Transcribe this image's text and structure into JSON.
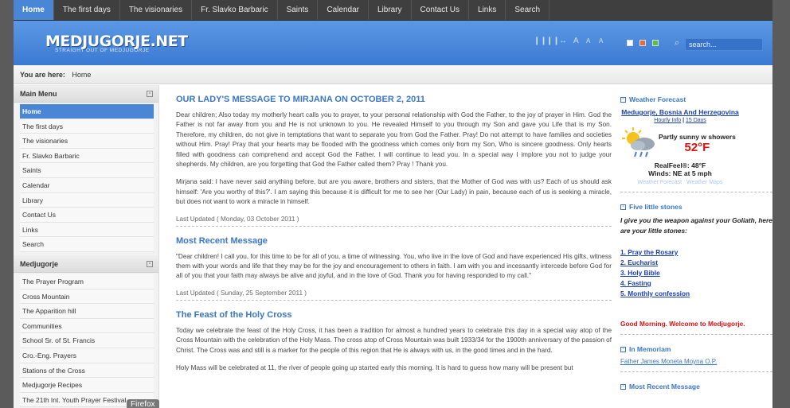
{
  "nav": {
    "items": [
      "Home",
      "The first days",
      "The visionaries",
      "Fr. Slavko Barbaric",
      "Saints",
      "Calendar",
      "Library",
      "Contact Us",
      "Links",
      "Search"
    ]
  },
  "header": {
    "logo_title": "MEDJUGORJE.NET",
    "logo_subtitle": "STRAIGHT OUT OF MEDJUGORJE",
    "search_placeholder": "search..."
  },
  "breadcrumb": {
    "label": "You are here:",
    "current": "Home"
  },
  "main_menu": {
    "title": "Main Menu",
    "items": [
      "Home",
      "The first days",
      "The visionaries",
      "Fr. Slavko Barbaric",
      "Saints",
      "Calendar",
      "Library",
      "Contact Us",
      "Links",
      "Search"
    ]
  },
  "medjugorje_menu": {
    "title": "Medjugorje",
    "items": [
      "The Prayer Program",
      "Cross Mountain",
      "The Apparition hill",
      "Communities",
      "School Sr. of St. Francis",
      "Cro.-Eng. Prayers",
      "Stations of the Cross",
      "Medjugorje Recipes",
      "The 21th Int. Youth Prayer Festival"
    ]
  },
  "firefox_tip": "Firefox",
  "articles": [
    {
      "title": "OUR LADY'S MESSAGE TO MIRJANA ON OCTOBER 2, 2011",
      "paragraphs": [
        "Dear children; Also today my motherly heart calls you to prayer, to your personal relationship with God the Father, to the joy of prayer in Him. God the Father is not far away from you and He is not unknown to you. He revealed Himself to you through my Son and gave you Life that is my Son. Therefore, my children, do not give in temptations that want to separate you from God the Father. Pray! Do not attempt to have families and societies without Him. Pray! Pray that your hearts may be flooded with the goodness which comes only from my Son, Who is sincere goodness. Only hearts filled with goodness can comprehend and accept God the Father. I will continue to lead you. In a special way I implore you not to judge your shepherds. My children, are you forgetting that God the Father called them? Pray ! Thank you.",
        "Mirjana said: I have never said anything before, but are you aware, brothers and sisters, that the Mother of God was with us? Each of us should ask himself: 'Are you worthy of this?'. I am saying this because it is difficult for me to see her (Our Lady) in pain, because each of us is seeking a miracle, but does not want to work a miracle in himself."
      ],
      "updated": "Last Updated ( Monday, 03 October 2011 )"
    },
    {
      "title": "Most Recent Message",
      "paragraphs": [
        "\"Dear children! I call you, for this time to be for all of you, a time of witnessing. You, who live in the love of God and have experienced His gifts, witness them with your words and life that they may be for the joy and encouragement to others in faith. I am with you and incessantly intercede before God for all of you that your faith may always be alive and joyful, and in the love of God. Thank you for having responded to my call.\""
      ],
      "updated": "Last Updated ( Sunday, 25 September 2011 )"
    },
    {
      "title": "The Feast of the Holy Cross",
      "paragraphs": [
        "Today we celebrate the feast of the Holy Cross, it has been a tradition for almost a hundred years to celebrate this day in a special way atop of the Cross Mountain with the celebration of the Holy Mass. The cross  atop of Cross Mountain was built 1933/34 for the 1900th anniversary of the passion of Christ. The Cross was and still is a marker for the people of this region that He is always with us, in the good times and in the hard.",
        "Holy Mass will be celebrated at 11, the river of people going up started early this morning. It is hard to guess how many will be present but"
      ]
    }
  ],
  "weather": {
    "title": "Weather Forecast",
    "city": "Medugorje, Bosnia And Herzegovina",
    "link_hourly": "Hourly Info",
    "link_sep": " | ",
    "link_days": "15 Days",
    "condition": "Partly sunny w showers",
    "temp": "52°F",
    "realfeel": "RealFeel®: 48°F",
    "winds": "Winds: NE at 5 mph",
    "foot_forecast": "Weather Forecast",
    "foot_maps": "Weather Maps"
  },
  "stones": {
    "title": "Five little stones",
    "intro": "I give you the weapon against your Goliath, here are your little stones:",
    "items": [
      "1. Pray the Rosary",
      "2. Eucharist",
      "3. Holy Bible",
      "4. Fasting",
      "5. Monthly confession"
    ]
  },
  "greeting": "Good Morning. Welcome to Medjugorje.",
  "memoriam": {
    "title": "In Memoriam",
    "link": "Father James Moneta Moyna O.P."
  },
  "recent_title": "Most Recent Message",
  "colors": {
    "accent": "#4a86d6",
    "link": "#3a76c8",
    "greeting": "#dd1111"
  }
}
